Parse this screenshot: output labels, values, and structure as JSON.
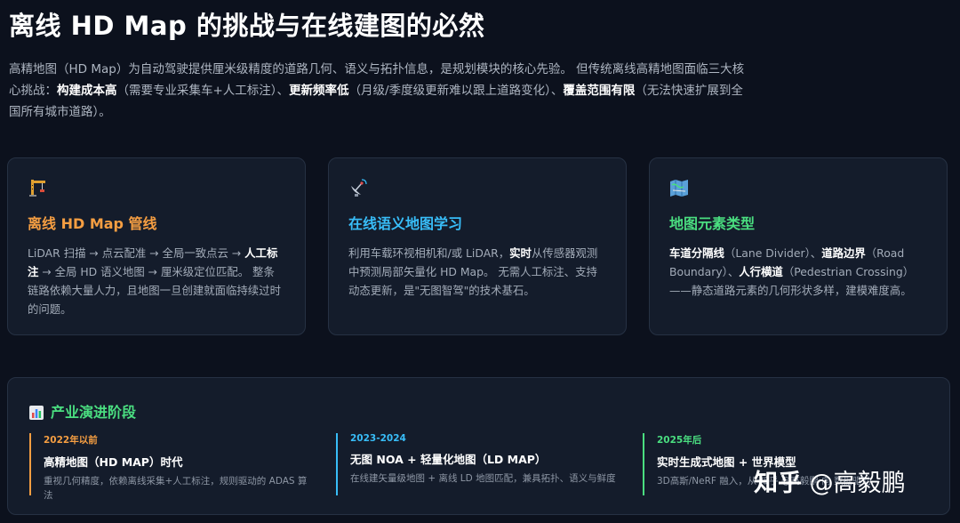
{
  "title": "离线 HD Map 的挑战与在线建图的必然",
  "intro": {
    "text1": "高精地图（HD Map）为自动驾驶提供厘米级精度的道路几何、语义与拓扑信息，是规划模块的核心先验。 但传统离线高精地图面临三大核心挑战：",
    "bold1": "构建成本高",
    "text2": "（需要专业采集车+人工标注）、",
    "bold2": "更新频率低",
    "text3": "（月级/季度级更新难以跟上道路变化）、",
    "bold3": "覆盖范围有限",
    "text4": "（无法快速扩展到全国所有城市道路）。"
  },
  "cards": [
    {
      "icon": "construction-crane-icon",
      "title": "离线 HD Map 管线",
      "title_color": "#f59e42",
      "body_a": "LiDAR 扫描 → 点云配准 → 全局一致点云 → ",
      "body_bold": "人工标注",
      "body_b": " → 全局 HD 语义地图 → 厘米级定位匹配。 整条链路依赖大量人力，且地图一旦创建就面临持续过时的问题。"
    },
    {
      "icon": "satellite-dish-icon",
      "title": "在线语义地图学习",
      "title_color": "#38bdf8",
      "body_a": "利用车载环视相机和/或 LiDAR，",
      "body_bold": "实时",
      "body_b": "从传感器观测中预测局部矢量化 HD Map。 无需人工标注、支持动态更新，是\"无图智驾\"的技术基石。"
    },
    {
      "icon": "map-icon",
      "title": "地图元素类型",
      "title_color": "#4ade80",
      "b1": "车道分隔线",
      "t1": "（Lane Divider）、",
      "b2": "道路边界",
      "t2": "（Road Boundary）、",
      "b3": "人行横道",
      "t3": "（Pedestrian Crossing）——静态道路元素的几何形状多样，建模难度高。"
    }
  ],
  "timeline": {
    "icon": "bar-chart-icon",
    "title": "产业演进阶段",
    "phases": [
      {
        "time": "2022年以前",
        "color": "#f59e42",
        "name": "高精地图（HD MAP）时代",
        "desc": "重视几何精度，依赖离线采集+人工标注，规则驱动的 ADAS 算法"
      },
      {
        "time": "2023-2024",
        "color": "#38bdf8",
        "name": "无图 NOA + 轻量化地图（LD MAP）",
        "desc": "在线建矢量级地图 + 离线 LD 地图匹配，兼具拓扑、语义与鲜度"
      },
      {
        "time": "2025年后",
        "color": "#4ade80",
        "name": "实时生成式地图 + 世界模型",
        "desc": "3D高斯/NeRF 融入，从 知乎 @高毅鹏 向 数据驱动"
      }
    ]
  },
  "watermark": {
    "brand": "知乎",
    "handle": "@高毅鹏"
  }
}
